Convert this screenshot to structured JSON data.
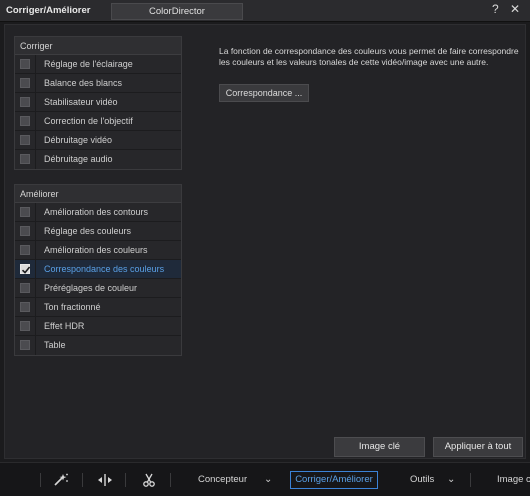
{
  "window": {
    "title": "Corriger/Améliorer",
    "tab": "ColorDirector",
    "help_icon": "question-icon",
    "close_icon": "close-icon"
  },
  "correct_group": {
    "header": "Corriger",
    "items": [
      {
        "label": "Réglage de l'éclairage",
        "checked": false
      },
      {
        "label": "Balance des blancs",
        "checked": false
      },
      {
        "label": "Stabilisateur vidéo",
        "checked": false
      },
      {
        "label": "Correction de l'objectif",
        "checked": false
      },
      {
        "label": "Débruitage vidéo",
        "checked": false
      },
      {
        "label": "Débruitage audio",
        "checked": false
      }
    ]
  },
  "enhance_group": {
    "header": "Améliorer",
    "items": [
      {
        "label": "Amélioration des contours",
        "checked": false
      },
      {
        "label": "Réglage des couleurs",
        "checked": false
      },
      {
        "label": "Amélioration des couleurs",
        "checked": false
      },
      {
        "label": "Correspondance des couleurs",
        "checked": true,
        "selected": true
      },
      {
        "label": "Préréglages de couleur",
        "checked": false
      },
      {
        "label": "Ton fractionné",
        "checked": false
      },
      {
        "label": "Effet HDR",
        "checked": false
      },
      {
        "label": "Table",
        "checked": false
      }
    ]
  },
  "detail": {
    "description": "La fonction de correspondance des couleurs vous permet de faire correspondre les couleurs et les valeurs tonales de cette vidéo/image avec une autre.",
    "button": "Correspondance ..."
  },
  "footer": {
    "keyframe": "Image clé",
    "apply_all": "Appliquer à tout"
  },
  "toolbar": {
    "icons": [
      "magic-wand-icon",
      "split-icon",
      "scissors-icon"
    ],
    "designer": "Concepteur",
    "fix_enhance": "Corriger/Améliorer",
    "tools": "Outils",
    "image_cut": "Image c"
  },
  "colors": {
    "accent": "#3b82d6",
    "selected_text": "#5aa0e6"
  }
}
